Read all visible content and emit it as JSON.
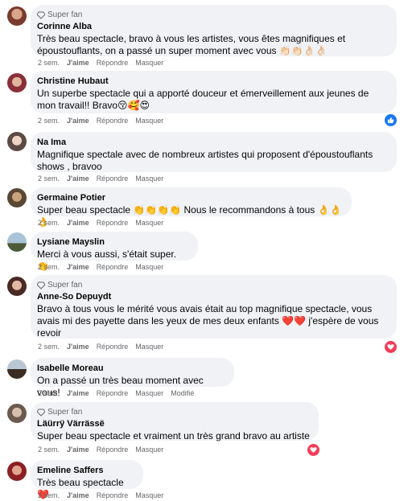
{
  "comments": [
    {
      "badge": "Super fan",
      "name": "Corinne Alba",
      "text": "Très beau spectacle, bravo à vous les artistes, vous êtes magnifiques et époustouflants, on a passé un super moment avec vous 👏🏻👏🏻👌🏻👌🏻",
      "time": "2 sem.",
      "like": "J'aime",
      "reply": "Répondre",
      "hide": "Masquer"
    },
    {
      "name": "Christine Hubaut",
      "text": "Un superbe spectacle qui a apporté douceur et émerveillement aux jeunes de mon travail!! Bravo😚🥰😍",
      "time": "2 sem.",
      "like": "J'aime",
      "reply": "Répondre",
      "hide": "Masquer"
    },
    {
      "name": "Na Ima",
      "text": "Magnifique spectale avec de nombreux artistes qui proposent d'époustouflants shows , bravoo",
      "time": "2 sem.",
      "like": "J'aime",
      "reply": "Répondre",
      "hide": "Masquer"
    },
    {
      "name": "Germaine Potier",
      "text": "Super beau spectacle 👏👏👏👏 Nous le recommandons à tous 👌👌👌",
      "time": "2 sem.",
      "like": "J'aime",
      "reply": "Répondre",
      "hide": "Masquer"
    },
    {
      "name": "Lysiane Mayslin",
      "text": "Merci à vous aussi, s'était super. 👏",
      "time": "2 sem.",
      "like": "J'aime",
      "reply": "Répondre",
      "hide": "Masquer"
    },
    {
      "badge": "Super fan",
      "name": "Anne-So Depuydt",
      "text": "Bravo à tous vous le mérité vous avais était au top magnifique spectacle, vous avais mi des payette dans les yeux de mes deux enfants ❤️❤️ j'espère de vous revoir",
      "time": "2 sem.",
      "like": "J'aime",
      "reply": "Répondre",
      "hide": "Masquer"
    },
    {
      "name": "Isabelle Moreau",
      "text": "On a passé un très beau moment avec vous!",
      "time": "2 sem.",
      "like": "J'aime",
      "reply": "Répondre",
      "hide": "Masquer",
      "edited": "Modifié"
    },
    {
      "badge": "Super fan",
      "name": "Läürrÿ Värrässë",
      "text": "Super beau spectacle et vraiment un très grand bravo au artiste",
      "time": "2 sem.",
      "like": "J'aime",
      "reply": "Répondre",
      "hide": "Masquer"
    },
    {
      "name": "Emeline Saffers",
      "text": "Très beau spectacle ❤️",
      "time": "2 sem.",
      "like": "J'aime",
      "reply": "Répondre",
      "hide": "Masquer"
    }
  ],
  "colors": {
    "bubble": "#f0f2f5",
    "meta": "#65676b",
    "like": "#1877f2",
    "love": "#f33e58"
  },
  "icons": {
    "badge": "diamond-icon",
    "like_reaction": "thumbs-up-icon",
    "love_reaction": "heart-icon"
  }
}
